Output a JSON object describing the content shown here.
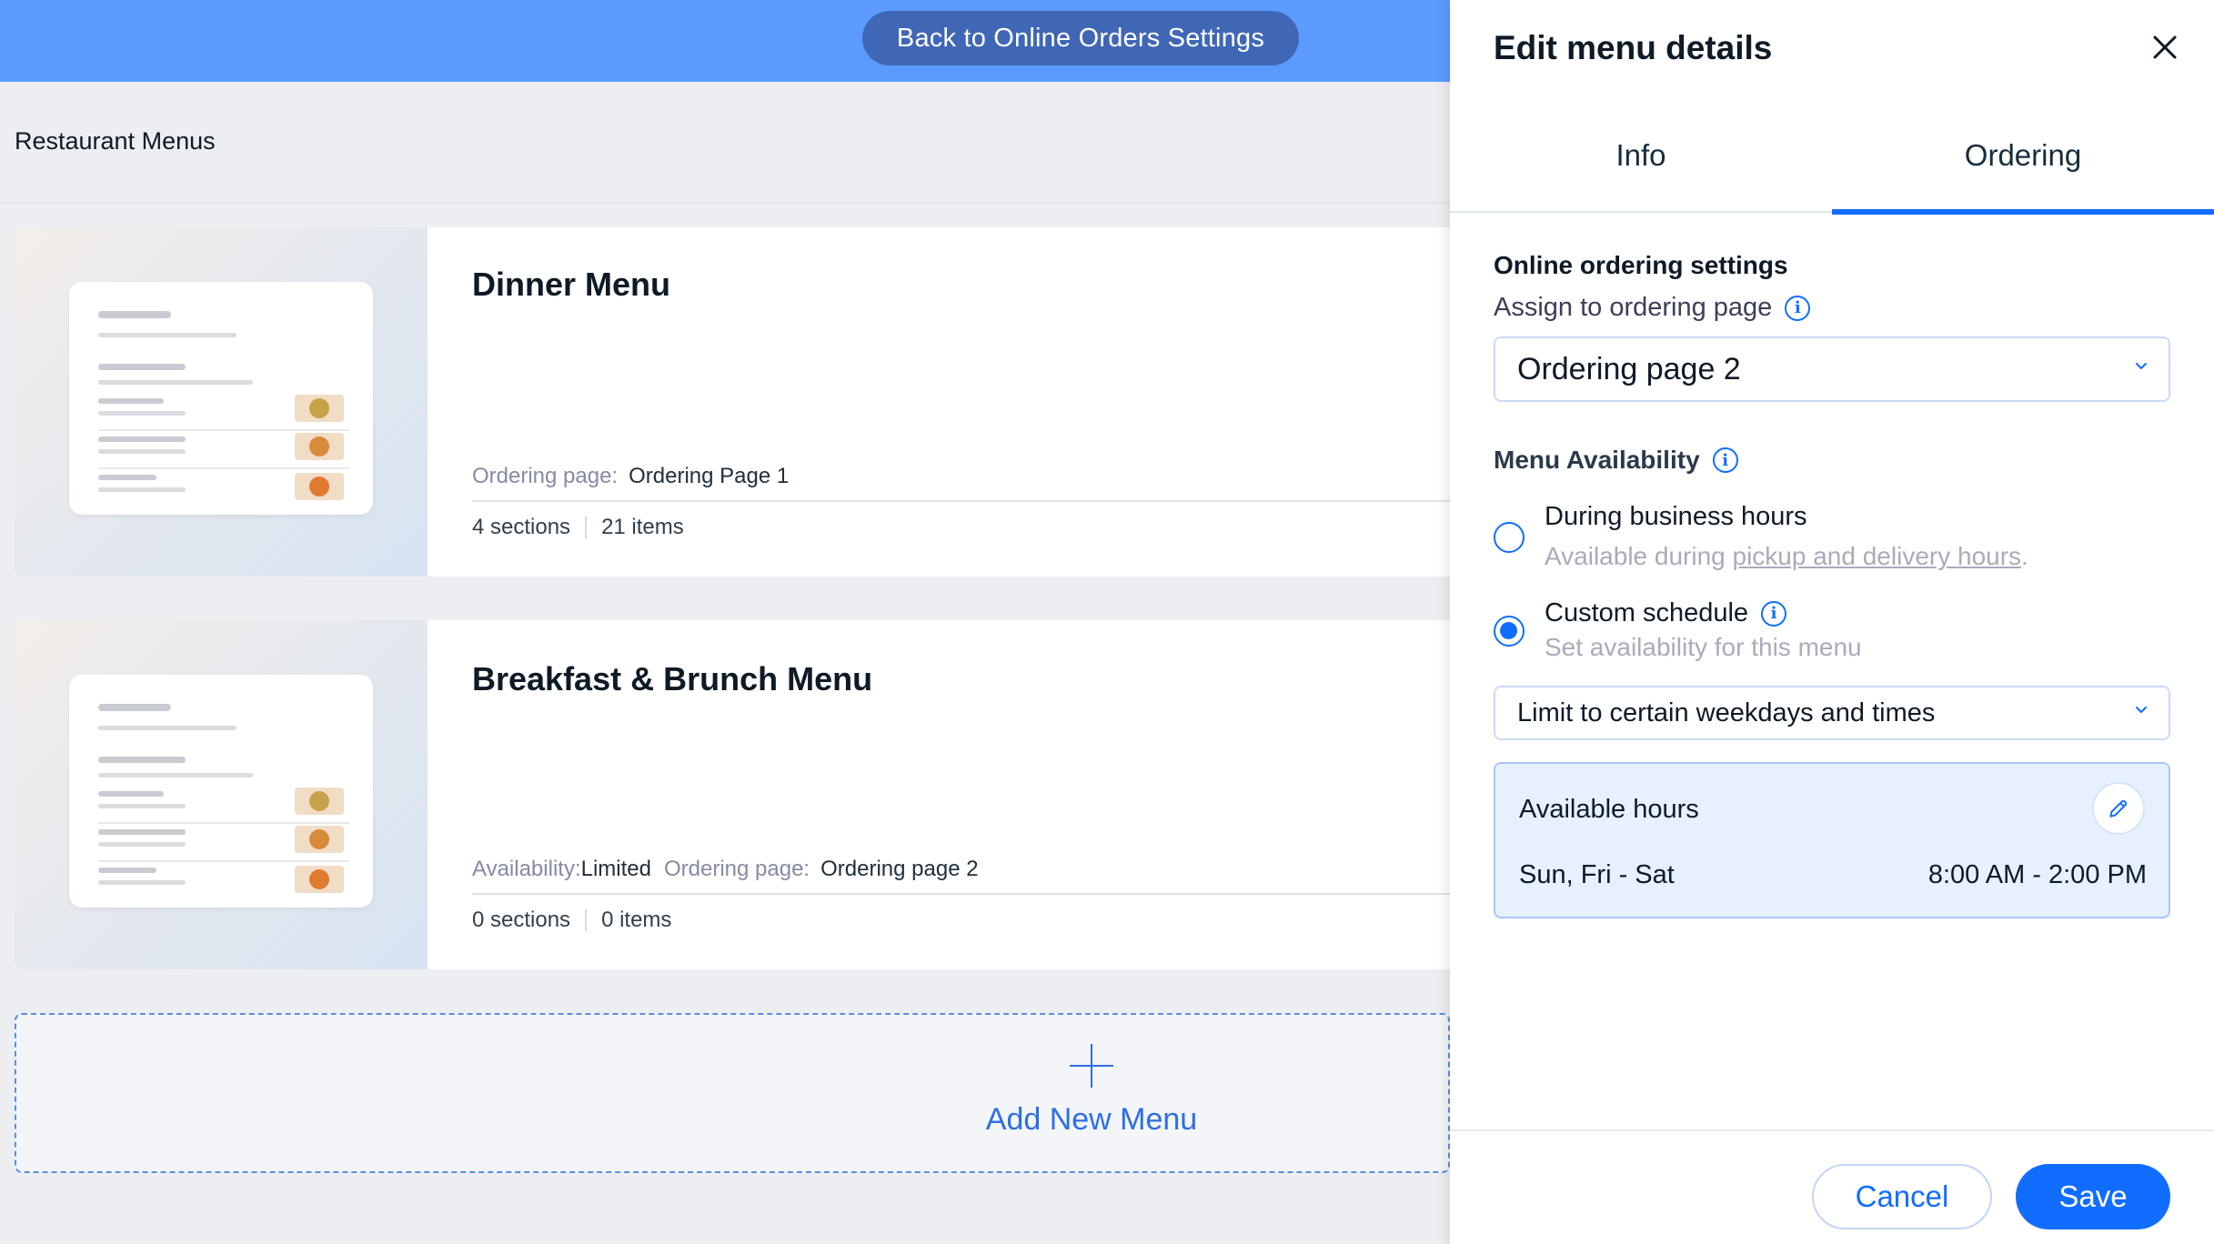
{
  "header": {
    "back_button_label": "Back to Online Orders Settings"
  },
  "page": {
    "title": "Restaurant Menus"
  },
  "menus": [
    {
      "title": "Dinner Menu",
      "meta": [
        {
          "label": "Ordering page:",
          "value": "Ordering Page 1"
        }
      ],
      "sections": "4 sections",
      "items": "21 items"
    },
    {
      "title": "Breakfast & Brunch Menu",
      "meta": [
        {
          "label": "Availability:",
          "value": "Limited"
        },
        {
          "label": "Ordering page:",
          "value": "Ordering page 2"
        }
      ],
      "sections": "0 sections",
      "items": "0 items"
    }
  ],
  "add_menu": {
    "label": "Add New Menu"
  },
  "panel": {
    "title": "Edit menu details",
    "tabs": [
      {
        "label": "Info",
        "active": false
      },
      {
        "label": "Ordering",
        "active": true
      }
    ],
    "online_ordering": {
      "title": "Online ordering settings",
      "assign_label": "Assign to ordering page",
      "selected_page": "Ordering page 2"
    },
    "availability": {
      "title": "Menu Availability",
      "options": [
        {
          "label": "During business hours",
          "sub_prefix": "Available during ",
          "sub_link": "pickup and delivery hours",
          "sub_suffix": ".",
          "checked": false
        },
        {
          "label": "Custom schedule",
          "sub": "Set availability for this menu",
          "checked": true
        }
      ],
      "limit_selected": "Limit to certain weekdays and times",
      "hours": {
        "title": "Available hours",
        "days": "Sun, Fri - Sat",
        "time": "8:00 AM - 2:00 PM"
      }
    },
    "footer": {
      "cancel_label": "Cancel",
      "save_label": "Save"
    }
  },
  "colors": {
    "topbar": "#5b9bff",
    "back_button": "#4067b6",
    "accent": "#116dff",
    "hours_box": "#e7f0ff"
  },
  "icons": [
    "close-icon",
    "info-icon",
    "chevron-down-icon",
    "pencil-icon",
    "plus-icon"
  ]
}
